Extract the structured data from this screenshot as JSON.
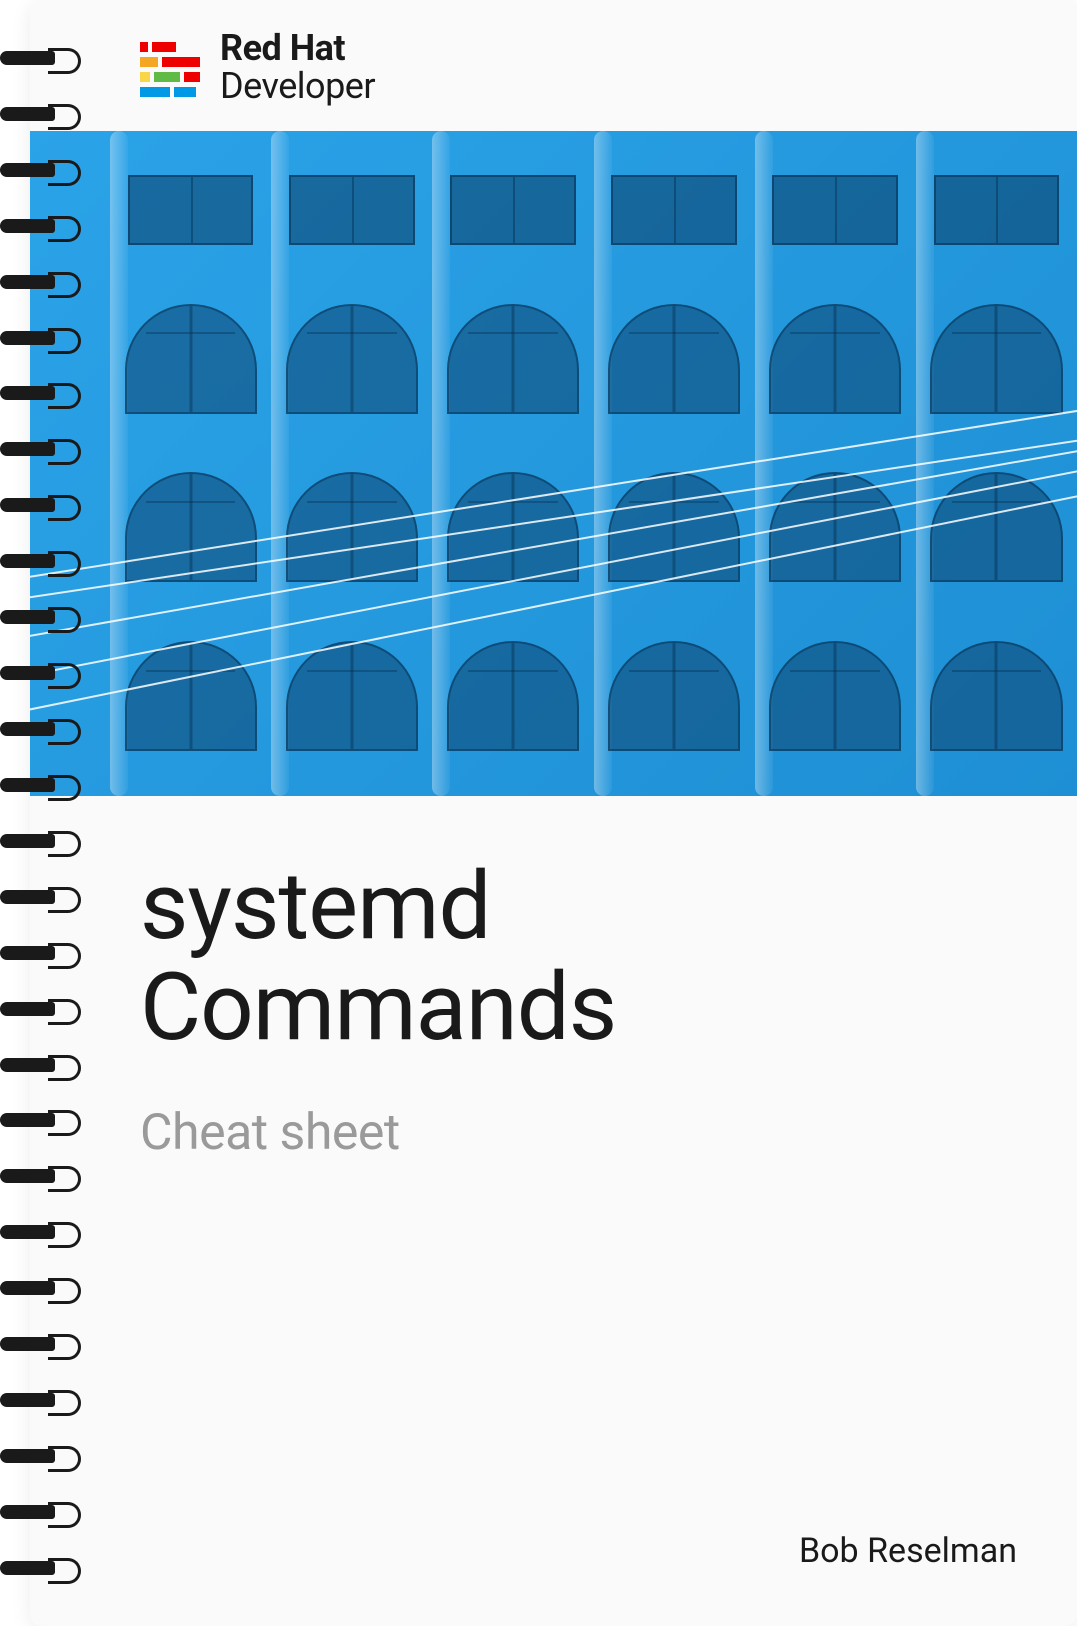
{
  "brand": {
    "name": "Red Hat",
    "product": "Developer",
    "colors": {
      "red": "#ee0000",
      "orange": "#f5a623",
      "yellow": "#f8d648",
      "green": "#5fbb46",
      "blue": "#0099e5"
    }
  },
  "hero": {
    "accent_color": "#2ba3e8"
  },
  "document": {
    "title_line1": "systemd",
    "title_line2": "Commands",
    "subtitle": "Cheat sheet",
    "author": "Bob Reselman"
  }
}
